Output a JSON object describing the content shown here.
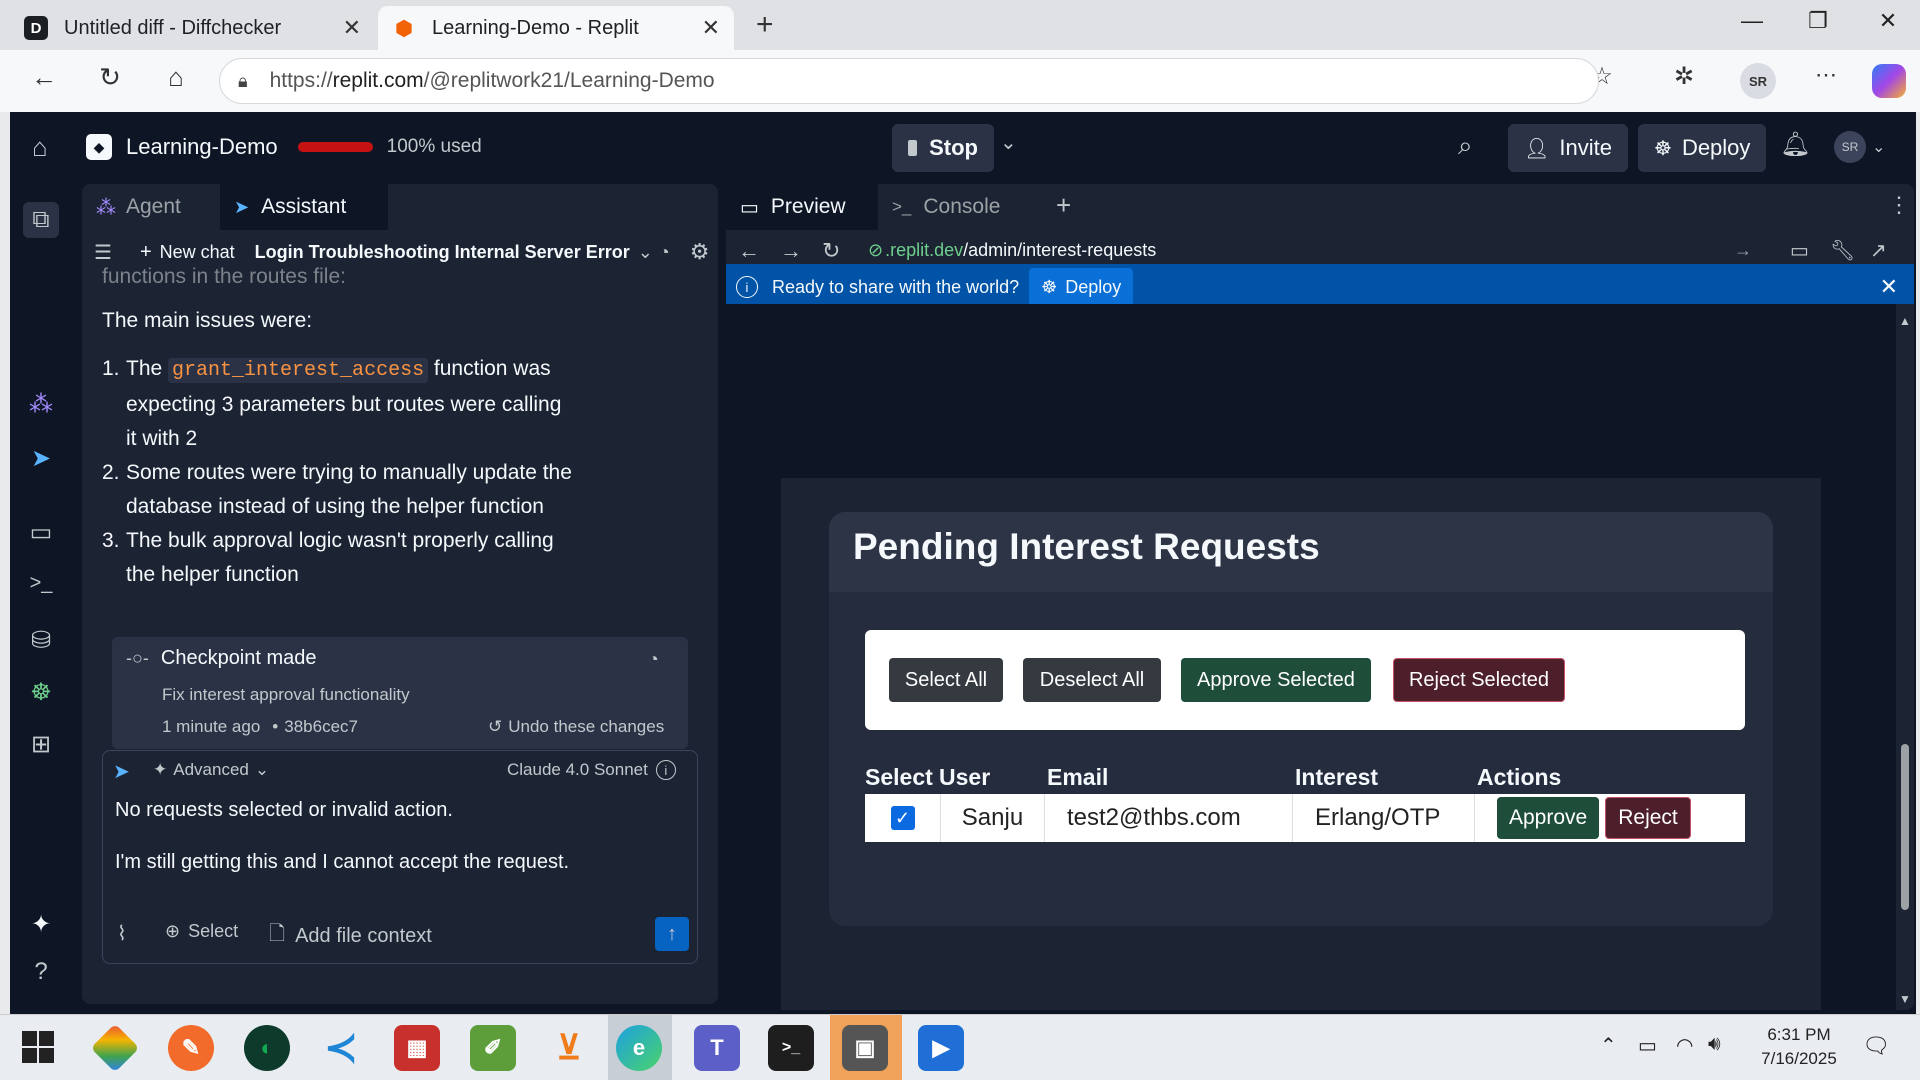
{
  "browser": {
    "tabs": [
      {
        "title": "Untitled diff - Diffchecker",
        "favicon": "D"
      },
      {
        "title": "Learning-Demo - Replit"
      }
    ],
    "url_prefix": "https://",
    "url_host": "replit.com",
    "url_path": "/@replitwork21/Learning-Demo",
    "profile": "SR"
  },
  "app": {
    "project_name": "Learning-Demo",
    "usage": "100% used",
    "stop_label": "Stop",
    "invite_label": "Invite",
    "deploy_label": "Deploy",
    "avatar": "SR"
  },
  "left": {
    "tabs": {
      "agent": "Agent",
      "assistant": "Assistant"
    },
    "new_chat": "New chat",
    "chat_title": "Login Troubleshooting Internal Server Error",
    "cutoff_text": "functions in the routes file:",
    "intro": "The main issues were:",
    "issues": [
      {
        "num": "1.",
        "pre": "The ",
        "code": "grant_interest_access",
        "post": " function was expecting 3 parameters but routes were calling it with 2"
      },
      {
        "num": "2.",
        "text": "Some routes were trying to manually update the database instead of using the helper function"
      },
      {
        "num": "3.",
        "text": "The bulk approval logic wasn't properly calling the helper function"
      }
    ],
    "checkpoint": {
      "title": "Checkpoint made",
      "desc": "Fix interest approval functionality",
      "time": "1 minute ago",
      "commit": "38b6cec7",
      "undo": "Undo these changes"
    },
    "composer": {
      "mode": "Advanced",
      "model": "Claude 4.0 Sonnet",
      "line1": "No requests selected or invalid action.",
      "line2": "I'm still getting this and I cannot accept the request.",
      "select_label": "Select",
      "file_ctx_label": "Add file context"
    }
  },
  "right": {
    "tabs": {
      "preview": "Preview",
      "console": "Console"
    },
    "preview_url_host": ".replit.dev",
    "preview_url_path": "/admin/interest-requests",
    "banner_text": "Ready to share with the world?",
    "banner_deploy": "Deploy",
    "page": {
      "title": "Pending Interest Requests",
      "buttons": {
        "select_all": "Select All",
        "deselect_all": "Deselect All",
        "approve_selected": "Approve Selected",
        "reject_selected": "Reject Selected"
      },
      "columns": [
        "Select",
        "User",
        "Email",
        "Interest",
        "Actions"
      ],
      "rows": [
        {
          "user": "Sanju",
          "email": "test2@thbs.com",
          "interest": "Erlang/OTP",
          "approve": "Approve",
          "reject": "Reject",
          "checked": true
        }
      ]
    }
  },
  "taskbar": {
    "time": "6:31 PM",
    "date": "7/16/2025"
  },
  "colors": {
    "accent_blue": "#0053a6",
    "danger": "#c61212",
    "approve_green": "#1e4d3a",
    "reject_red": "#4d1f2a"
  }
}
